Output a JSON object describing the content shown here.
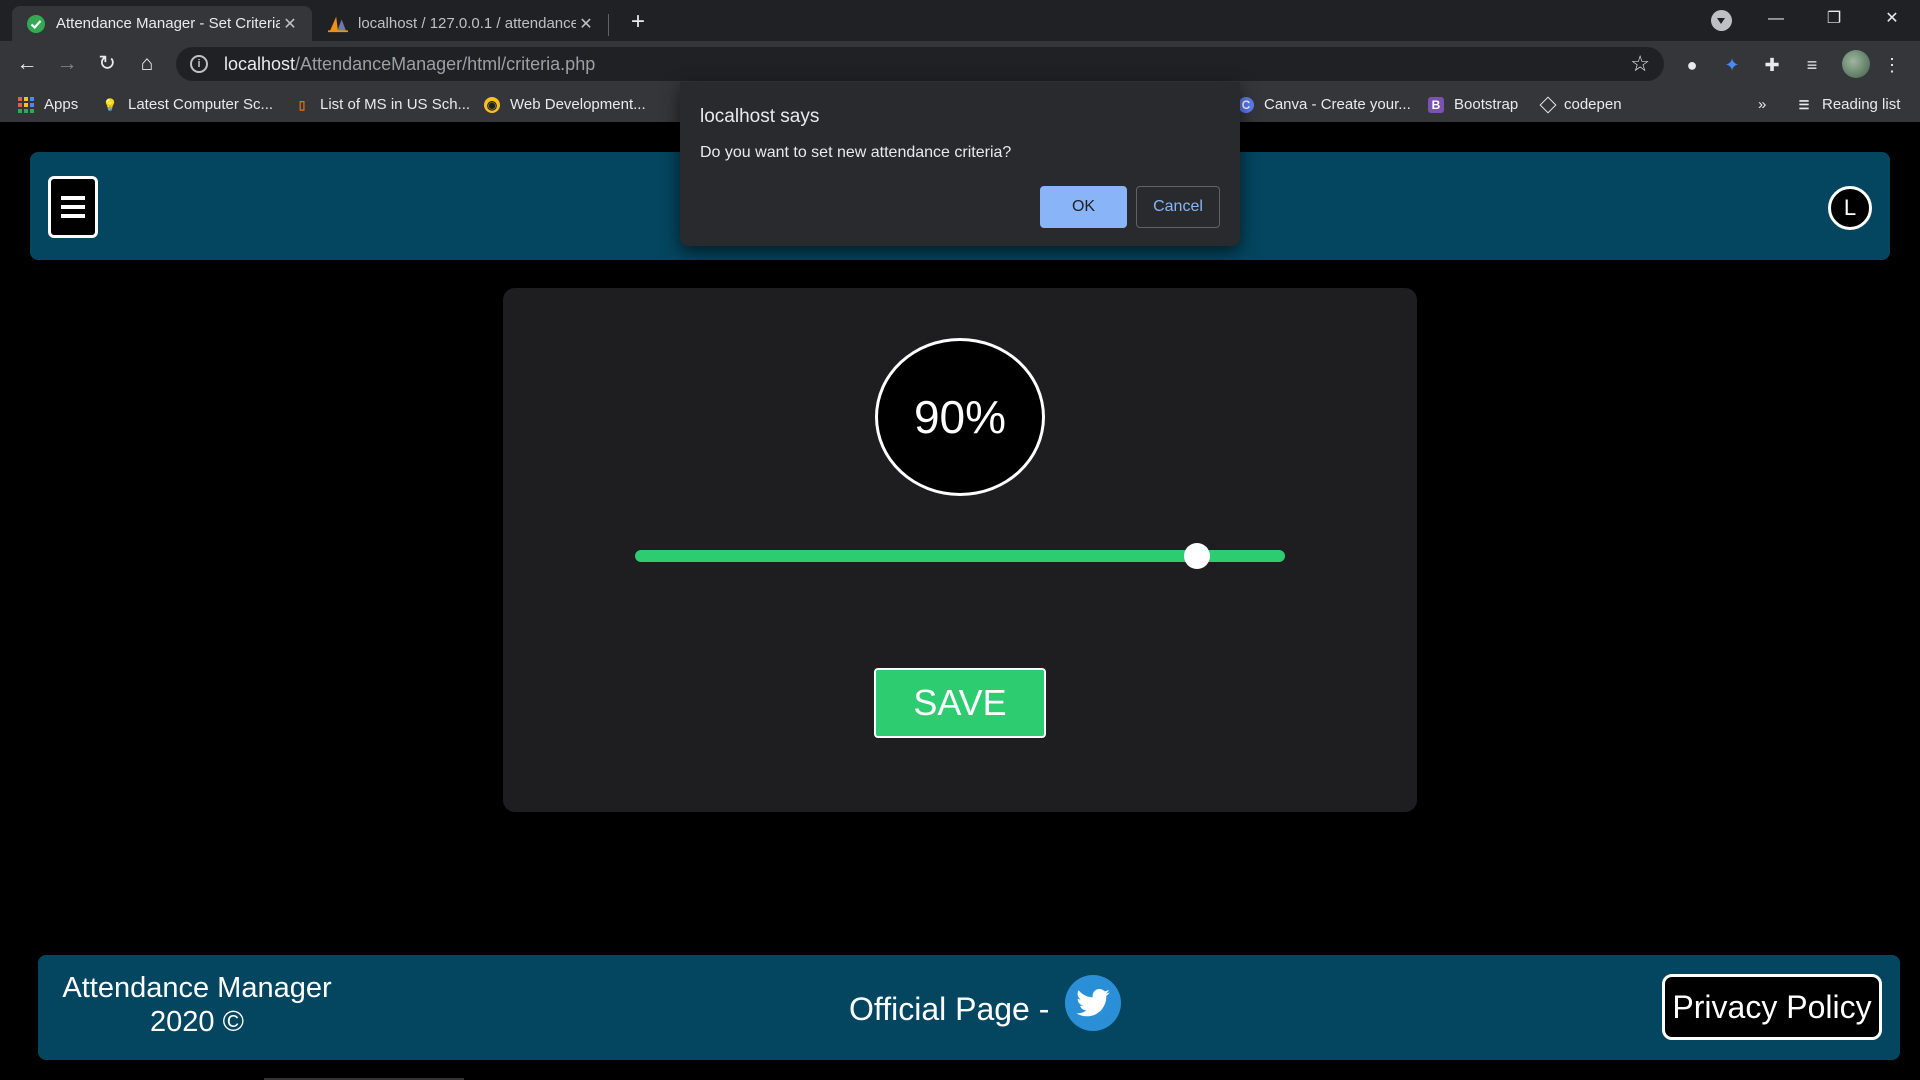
{
  "browser": {
    "tabs": [
      {
        "title": "Attendance Manager - Set Criteria",
        "active": true
      },
      {
        "title": "localhost / 127.0.0.1 / attendance",
        "active": false
      }
    ],
    "url_host": "localhost",
    "url_path": "/AttendanceManager/html/criteria.php",
    "bookmarks": [
      {
        "label": "Apps",
        "icon": "apps-grid-icon"
      },
      {
        "label": "Latest Computer Sc...",
        "icon": "bulb-icon"
      },
      {
        "label": "List of MS in US Sch...",
        "icon": "bookmark-icon"
      },
      {
        "label": "Web Development...",
        "icon": "globe-icon"
      },
      {
        "label": "Canva - Create your...",
        "icon": "canva-icon"
      },
      {
        "label": "Bootstrap",
        "icon": "bootstrap-icon"
      },
      {
        "label": "codepen",
        "icon": "codepen-icon"
      }
    ],
    "overflow": "»",
    "reading_list": "Reading list"
  },
  "header": {
    "logout_label": "L"
  },
  "criteria": {
    "percent_label": "90%",
    "slider_fraction": 0.865,
    "save_label": "SAVE"
  },
  "footer": {
    "brand_line1": "Attendance Manager",
    "brand_line2": "2020 ©",
    "official": "Official Page -",
    "privacy": "Privacy Policy"
  },
  "dialog": {
    "title": "localhost says",
    "message": "Do you want to set new attendance criteria?",
    "ok": "OK",
    "cancel": "Cancel"
  },
  "colors": {
    "header_bg": "#04465f",
    "accent_green": "#2ecc71",
    "card_bg": "#1e1e21",
    "dialog_ok": "#8ab4f8"
  }
}
